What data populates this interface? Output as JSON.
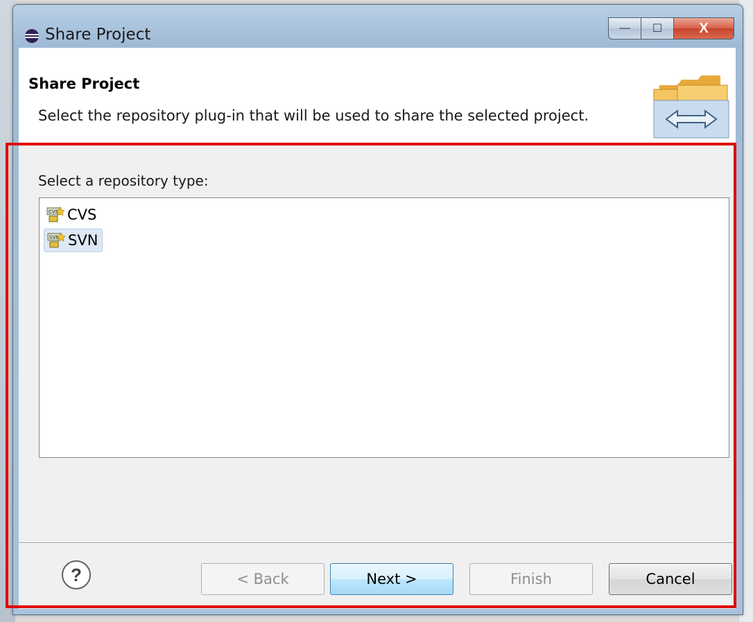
{
  "window": {
    "title": "Share Project",
    "minimize_glyph": "—",
    "maximize_glyph": "☐",
    "close_glyph": "X"
  },
  "wizard": {
    "title": "Share Project",
    "description": "Select the repository plug-in that will be used to share the selected project.",
    "prompt": "Select a repository type:",
    "repository_types": [
      {
        "label": "CVS",
        "selected": false
      },
      {
        "label": "SVN",
        "selected": true
      }
    ]
  },
  "buttons": {
    "help": "?",
    "back": "< Back",
    "next": "Next >",
    "finish": "Finish",
    "cancel": "Cancel"
  },
  "colors": {
    "highlight_border": "#e00000",
    "selection_bg": "#dde8f4",
    "default_button": "#bee6fd"
  }
}
